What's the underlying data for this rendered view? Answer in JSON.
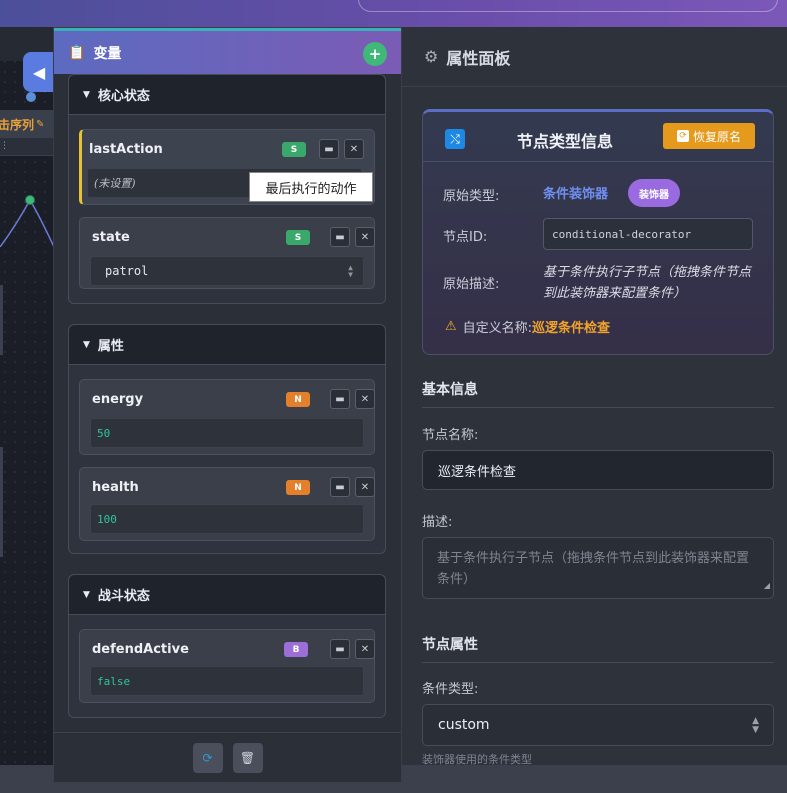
{
  "canvas": {
    "node_label": "击序列",
    "collapse_icon": "chevron-left-icon"
  },
  "variables_panel": {
    "title": "变量",
    "title_icon": "clipboard-icon",
    "add_icon": "plus-icon",
    "groups": [
      {
        "name": "核心状态",
        "items": [
          {
            "name": "lastAction",
            "type": "S",
            "value": "(未设置)",
            "tooltip": "最后执行的动作"
          },
          {
            "name": "state",
            "type": "S",
            "value": "patrol"
          }
        ]
      },
      {
        "name": "属性",
        "items": [
          {
            "name": "energy",
            "type": "N",
            "value": "50"
          },
          {
            "name": "health",
            "type": "N",
            "value": "100"
          }
        ]
      },
      {
        "name": "战斗状态",
        "items": [
          {
            "name": "defendActive",
            "type": "B",
            "value": "false"
          }
        ]
      }
    ],
    "footer": {
      "refresh_icon": "refresh-icon",
      "delete_icon": "trash-icon"
    }
  },
  "properties_panel": {
    "title": "属性面板",
    "title_icon": "gear-icon",
    "info_card": {
      "title": "节点类型信息",
      "restore_label": "恢复原名",
      "original_type_label": "原始类型:",
      "original_type_value": "条件装饰器",
      "type_pill": "装饰器",
      "node_id_label": "节点ID:",
      "node_id_value": "conditional-decorator",
      "original_desc_label": "原始描述:",
      "original_desc_value": "基于条件执行子节点（拖拽条件节点到此装饰器来配置条件）",
      "custom_name_label": "自定义名称:",
      "custom_name_value": "巡逻条件检查"
    },
    "basic_info": {
      "section_title": "基本信息",
      "name_label": "节点名称:",
      "name_value": "巡逻条件检查",
      "desc_label": "描述:",
      "desc_value": "基于条件执行子节点（拖拽条件节点到此装饰器来配置条件）"
    },
    "node_props": {
      "section_title": "节点属性",
      "condition_type_label": "条件类型:",
      "condition_type_value": "custom",
      "condition_type_help": "装饰器使用的条件类型"
    }
  },
  "colors": {
    "header_gradient_start": "#5c6bc0",
    "header_gradient_end": "#7b5bb5",
    "accent_orange": "#e69a1c",
    "accent_purple": "#9a6be0",
    "badge_string": "#3aa86a",
    "badge_number": "#e47f2b",
    "badge_boolean": "#9b6fd6"
  }
}
